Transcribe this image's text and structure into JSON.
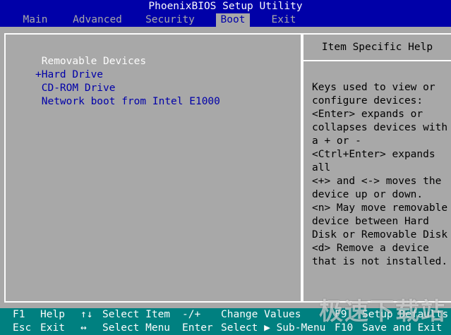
{
  "title": "PhoenixBIOS Setup Utility",
  "menu": [
    {
      "label": "Main"
    },
    {
      "label": "Advanced"
    },
    {
      "label": "Security"
    },
    {
      "label": "Boot"
    },
    {
      "label": "Exit"
    }
  ],
  "boot_list": [
    {
      "label": " Removable Devices"
    },
    {
      "label": "+Hard Drive"
    },
    {
      "label": " CD-ROM Drive"
    },
    {
      "label": " Network boot from Intel E1000"
    }
  ],
  "help": {
    "title": "Item Specific Help",
    "lines": [
      "Keys used to view or",
      "configure devices:",
      "<Enter> expands or",
      "collapses devices with",
      "a + or -",
      "<Ctrl+Enter> expands",
      "all",
      "<+> and <-> moves the",
      "device up or down.",
      "<n> May move removable",
      "device between Hard",
      "Disk or Removable Disk",
      "<d> Remove a device",
      "that is not installed."
    ]
  },
  "footer": {
    "row1": [
      {
        "key": "F1",
        "desc": "Help"
      },
      {
        "key": "↑↓",
        "desc": "Select Item"
      },
      {
        "key": "-/+",
        "desc": "Change Values"
      },
      {
        "key": "F9",
        "desc": "Setup Defaults"
      }
    ],
    "row2": [
      {
        "key": "Esc",
        "desc": "Exit"
      },
      {
        "key": "↔",
        "desc": "Select Menu"
      },
      {
        "key": "Enter",
        "desc": "Select ▶ Sub-Menu"
      },
      {
        "key": "F10",
        "desc": "Save and Exit"
      }
    ]
  },
  "watermark": "极速下载站"
}
